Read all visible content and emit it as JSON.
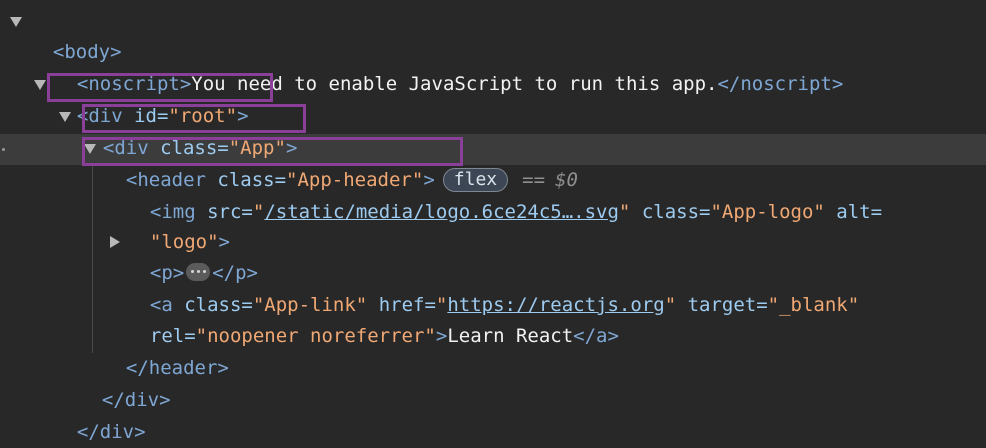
{
  "tree": {
    "body_open": "<body>",
    "noscript_open": "<noscript>",
    "noscript_text": "You need to enable JavaScript to run this app.",
    "noscript_close": "</noscript>",
    "root_div": {
      "open": "<div ",
      "attr": "id=",
      "val": "\"root\"",
      "close": ">"
    },
    "app_div": {
      "open": "<div ",
      "attr": "class=",
      "val": "\"App\"",
      "close": ">"
    },
    "header": {
      "open": "<header ",
      "attr": "class=",
      "val": "\"App-header\"",
      "close": ">",
      "badge": "flex",
      "eq": "==",
      "ref": "$0"
    },
    "img": {
      "open": "<img ",
      "src_attr": "src=",
      "src_q1": "\"",
      "src_val": "/static/media/logo.6ce24c5….svg",
      "src_q2": "\"",
      "class_attr": " class=",
      "class_val": "\"App-logo\"",
      "alt_attr": " alt=",
      "alt_val": "\"logo\"",
      "close": ">"
    },
    "p": {
      "open": "<p>",
      "close": "</p>"
    },
    "a": {
      "open": "<a ",
      "class_attr": "class=",
      "class_val": "\"App-link\"",
      "href_attr": " href=",
      "href_q1": "\"",
      "href_val": "https://reactjs.org",
      "href_q2": "\"",
      "target_attr": " target=",
      "target_val": "\"_blank\"",
      "rel_attr": "rel=",
      "rel_val": "\"noopener noreferrer\"",
      "close_bracket": ">",
      "text": "Learn React",
      "close": "</a>"
    },
    "header_close": "</header>",
    "app_div_close": "</div>",
    "root_div_close": "</div>"
  },
  "colors": {
    "background": "#282828",
    "tag": "#7fa7d4",
    "attribute": "#9ecbf0",
    "value": "#f0a874",
    "highlight_box": "#8a3f98",
    "selected_row": "#3c3c3c"
  }
}
